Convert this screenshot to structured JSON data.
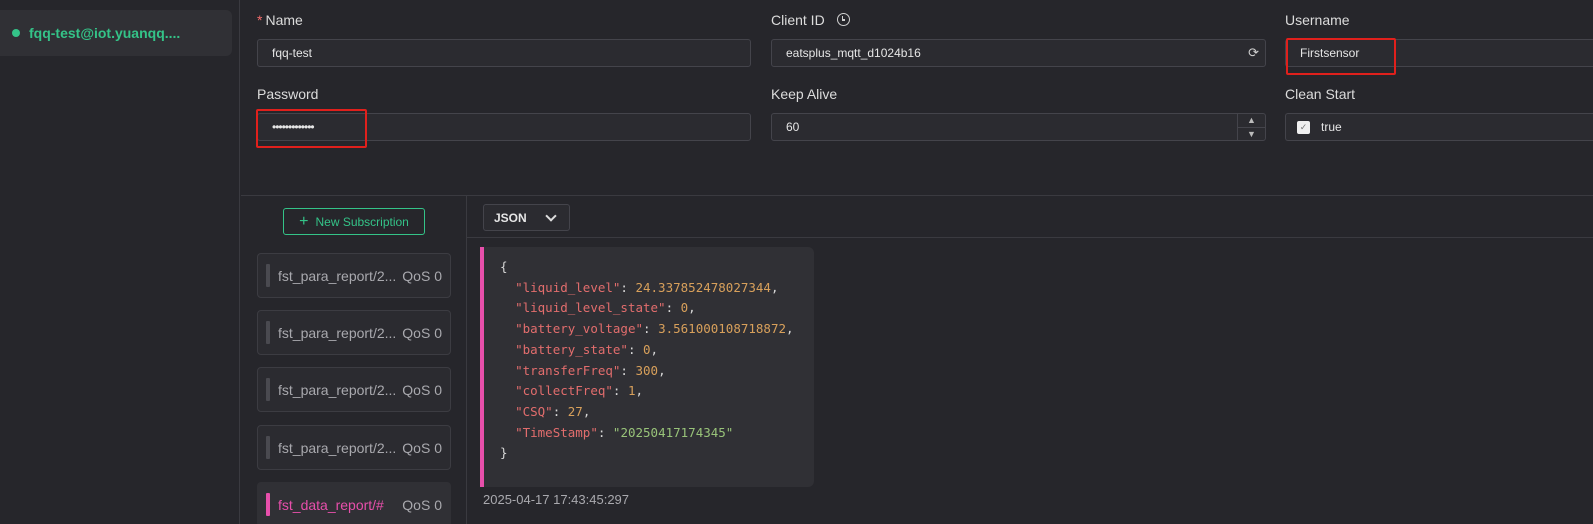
{
  "sidebar": {
    "connection_name": "fqq-test@iot.yuanqq...."
  },
  "form": {
    "name_label": "Name",
    "name_value": "fqq-test",
    "client_id_label": "Client ID",
    "client_id_value": "eatsplus_mqtt_d1024b16",
    "username_label": "Username",
    "username_value": "Firstsensor",
    "password_label": "Password",
    "password_value": "•••••••••••••",
    "keep_alive_label": "Keep Alive",
    "keep_alive_value": "60",
    "clean_start_label": "Clean Start",
    "clean_start_value": "true"
  },
  "subscriptions": {
    "new_button_label": "New Subscription",
    "items": [
      {
        "topic": "fst_para_report/2...",
        "qos": "QoS 0"
      },
      {
        "topic": "fst_para_report/2...",
        "qos": "QoS 0"
      },
      {
        "topic": "fst_para_report/2...",
        "qos": "QoS 0"
      },
      {
        "topic": "fst_para_report/2...",
        "qos": "QoS 0"
      },
      {
        "topic": "fst_data_report/#",
        "qos": "QoS 0"
      }
    ]
  },
  "messages": {
    "format": "JSON",
    "payload": {
      "open": "{",
      "close": "}",
      "lines": [
        {
          "key": "\"liquid_level\"",
          "value": "24.337852478027344",
          "kind": "n",
          "comma": ","
        },
        {
          "key": "\"liquid_level_state\"",
          "value": "0",
          "kind": "n",
          "comma": ","
        },
        {
          "key": "\"battery_voltage\"",
          "value": "3.561000108718872",
          "kind": "n",
          "comma": ","
        },
        {
          "key": "\"battery_state\"",
          "value": "0",
          "kind": "n",
          "comma": ","
        },
        {
          "key": "\"transferFreq\"",
          "value": "300",
          "kind": "n",
          "comma": ","
        },
        {
          "key": "\"collectFreq\"",
          "value": "1",
          "kind": "n",
          "comma": ","
        },
        {
          "key": "\"CSQ\"",
          "value": "27",
          "kind": "n",
          "comma": ","
        },
        {
          "key": "\"TimeStamp\"",
          "value": "\"20250417174345\"",
          "kind": "s",
          "comma": ""
        }
      ]
    },
    "timestamp": "2025-04-17 17:43:45:297"
  }
}
